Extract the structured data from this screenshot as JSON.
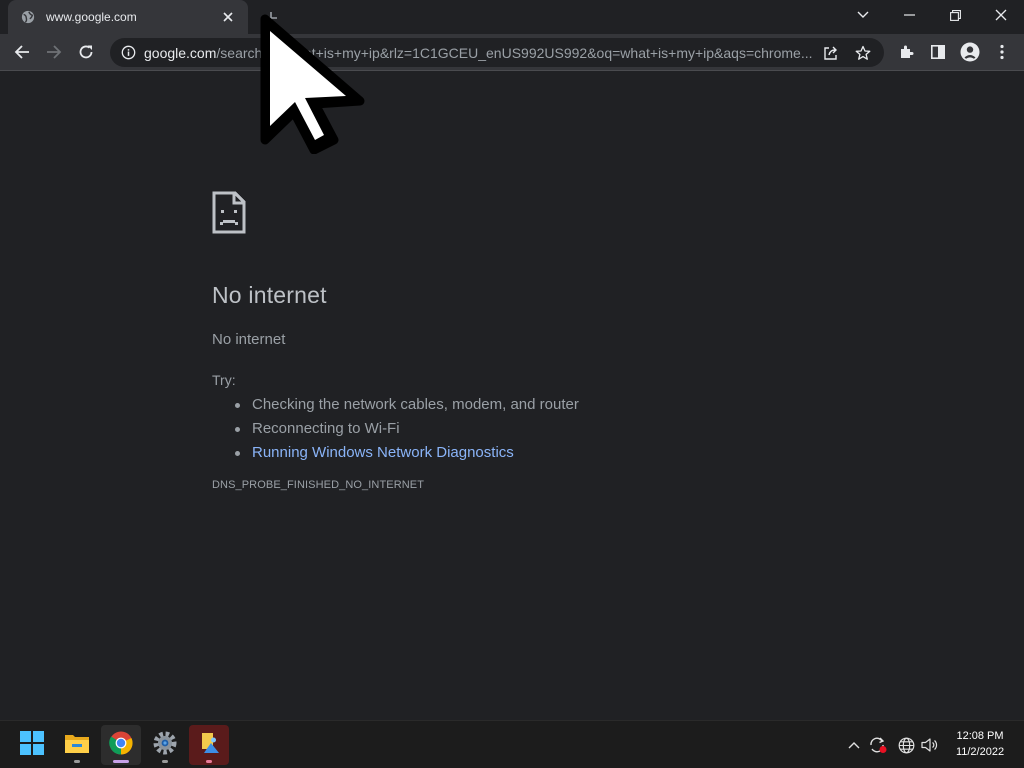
{
  "browser": {
    "tab": {
      "title": "www.google.com"
    },
    "omnibox": {
      "host": "google.com",
      "path": "/search?q=what+is+my+ip&rlz=1C1GCEU_enUS992US992&oq=what+is+my+ip&aqs=chrome..."
    }
  },
  "error_page": {
    "heading": "No internet",
    "subheading": "No internet",
    "try_label": "Try:",
    "suggestions": [
      "Checking the network cables, modem, and router",
      "Reconnecting to Wi-Fi"
    ],
    "diagnostics_link": "Running Windows Network Diagnostics",
    "error_code": "DNS_PROBE_FINISHED_NO_INTERNET"
  },
  "taskbar": {
    "apps": [
      "start-icon",
      "file-explorer-icon",
      "chrome-icon",
      "settings-icon",
      "photos-icon"
    ],
    "active_app": "chrome-icon",
    "clock": {
      "time": "12:08 PM",
      "date": "11/2/2022"
    }
  },
  "colors": {
    "page_background": "#202124",
    "toolbar": "#35363a",
    "link": "#8ab4f8",
    "text_secondary": "#9aa0a6"
  }
}
